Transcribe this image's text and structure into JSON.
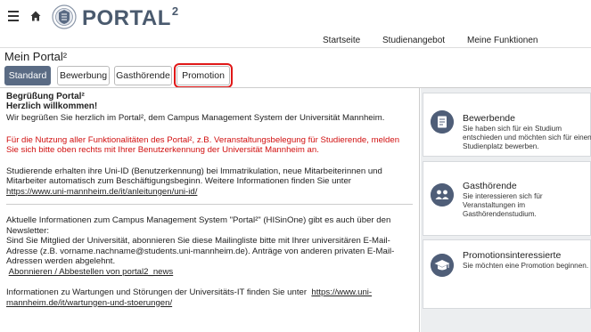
{
  "header": {
    "brand": "PORTAL",
    "brand_sup": "2",
    "nav": [
      "Startseite",
      "Studienangebot",
      "Meine Funktionen"
    ]
  },
  "page": {
    "title": "Mein Portal²"
  },
  "tabs": [
    {
      "label": "Standard",
      "active": true
    },
    {
      "label": "Bewerbung",
      "active": false
    },
    {
      "label": "Gasthörende",
      "active": false
    },
    {
      "label": "Promotion",
      "active": false,
      "highlighted": true
    }
  ],
  "content": {
    "heading1": "Begrüßung Portal²",
    "heading2": "Herzlich willkommen!",
    "intro": "Wir begrüßen Sie herzlich im Portal², dem Campus Management System der Universität Mannheim.",
    "notice": "Für die Nutzung aller Funktionalitäten des Portal², z.B. Veranstaltungsbelegung für Studierende, melden Sie sich bitte oben rechts mit Ihrer Benutzerkennung der Universität Mannheim an.",
    "uniid_text": "Studierende erhalten ihre Uni-ID (Benutzerkennung) bei Immatrikulation, neue Mitarbeiterinnen und Mitarbeiter automatisch zum Beschäftigungsbeginn. Weitere Informationen finden Sie unter",
    "uniid_link": "https://www.uni-mannheim.de/it/anleitungen/uni-id/",
    "news_text": "Aktuelle Informationen zum Campus Management System \"Portal²\" (HISinOne) gibt es auch über den Newsletter:",
    "mailing_text": "Sind Sie Mitglied der Universität, abonnieren Sie diese Mailingliste bitte mit Ihrer universitären E-Mail-Adresse (z.B. vorname.nachname@students.uni-mannheim.de). Anträge von anderen privaten E-Mail-Adressen werden abgelehnt.",
    "mailing_link": "Abonnieren / Abbestellen von portal2_news",
    "maint_text": "Informationen zu Wartungen und Störungen der Universitäts-IT finden Sie unter",
    "maint_link": "https://www.uni-mannheim.de/it/wartungen-und-stoerungen/"
  },
  "sidebar": [
    {
      "title": "Bewerbende",
      "desc": "Sie haben sich für ein Studium entschieden und möchten sich für einen Studienplatz bewerben.",
      "icon": "application-icon"
    },
    {
      "title": "Gasthörende",
      "desc": "Sie interessieren sich für Veranstaltungen im Gasthörendenstudium.",
      "icon": "group-icon"
    },
    {
      "title": "Promotionsinteressierte",
      "desc": "Sie möchten eine Promotion beginnen.",
      "icon": "graduation-cap-icon"
    }
  ]
}
